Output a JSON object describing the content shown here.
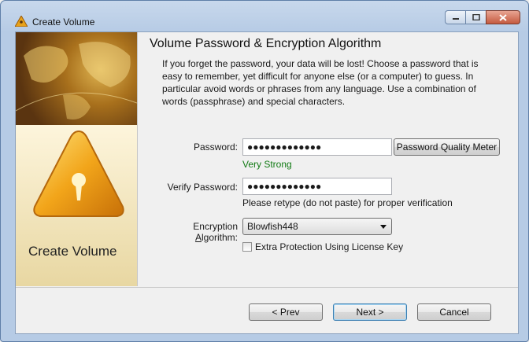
{
  "window": {
    "title": "Create Volume"
  },
  "sidebar": {
    "title": "Create Volume"
  },
  "page": {
    "heading": "Volume Password & Encryption Algorithm",
    "intro": "If you forget the password, your data will be lost! Choose a password that is easy to remember, yet difficult for anyone else (or a computer) to guess. In particular avoid words or phrases from any language. Use a combination of words (passphrase) and special characters."
  },
  "form": {
    "password_label": "Password:",
    "password_value": "●●●●●●●●●●●●●",
    "quality_button": "Password Quality Meter",
    "strength": "Very Strong",
    "verify_label": "Verify Password:",
    "verify_value": "●●●●●●●●●●●●●",
    "verify_hint": "Please retype (do not paste) for proper verification",
    "algorithm_label_pre": "Encryption ",
    "algorithm_label_accel": "A",
    "algorithm_label_post": "lgorithm:",
    "algorithm_value": "Blowfish448",
    "license_checkbox_label": "Extra Protection Using License Key",
    "license_checked": false
  },
  "buttons": {
    "prev": "< Prev",
    "next": "Next >",
    "cancel": "Cancel"
  },
  "colors": {
    "strength": "#117a14",
    "title_bar": "#b6cbe5"
  }
}
